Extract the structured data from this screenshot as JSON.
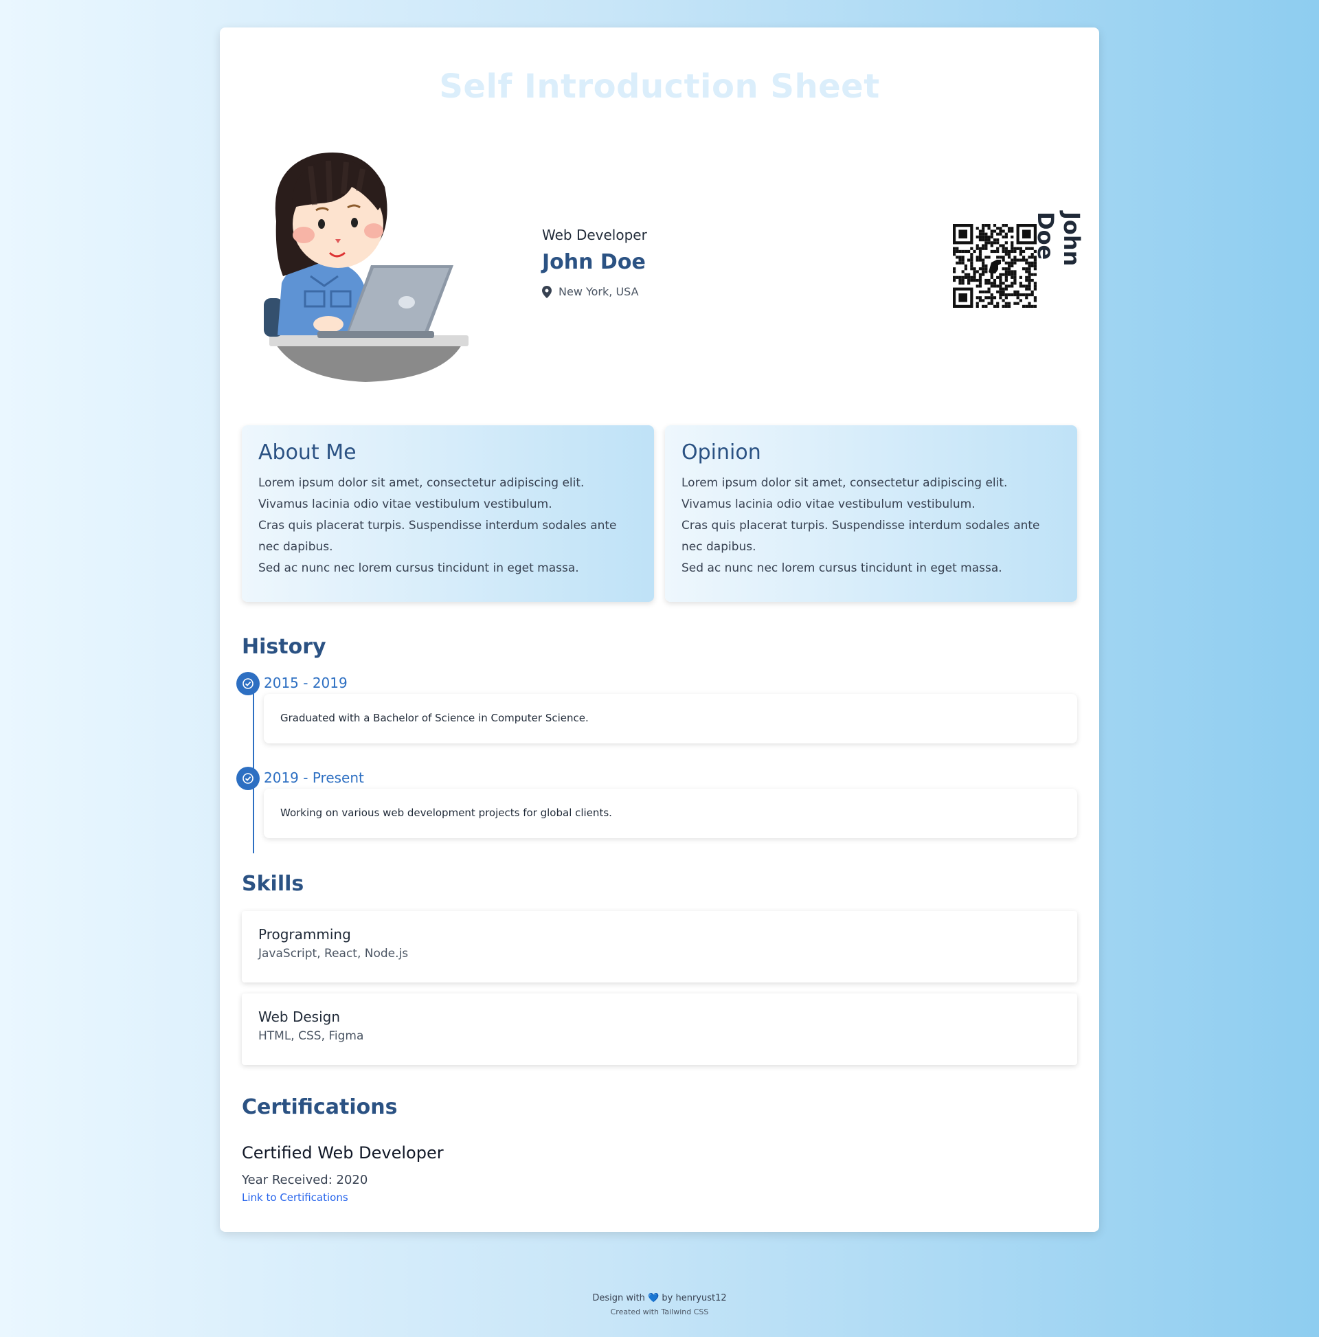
{
  "title": "Self Introduction Sheet",
  "profile": {
    "role": "Web Developer",
    "name": "John Doe",
    "location": "New York, USA",
    "vertical_name": "John Doe"
  },
  "about": {
    "heading": "About Me",
    "lines": [
      "Lorem ipsum dolor sit amet, consectetur adipiscing elit. Vivamus lacinia odio vitae vestibulum vestibulum.",
      "Cras quis placerat turpis. Suspendisse interdum sodales ante nec dapibus.",
      "Sed ac nunc nec lorem cursus tincidunt in eget massa."
    ]
  },
  "opinion": {
    "heading": "Opinion",
    "lines": [
      "Lorem ipsum dolor sit amet, consectetur adipiscing elit. Vivamus lacinia odio vitae vestibulum vestibulum.",
      "Cras quis placerat turpis. Suspendisse interdum sodales ante nec dapibus.",
      "Sed ac nunc nec lorem cursus tincidunt in eget massa."
    ]
  },
  "history": {
    "heading": "History",
    "items": [
      {
        "date": "2015 - 2019",
        "text": "Graduated with a Bachelor of Science in Computer Science."
      },
      {
        "date": "2019 - Present",
        "text": "Working on various web development projects for global clients."
      }
    ]
  },
  "skills": {
    "heading": "Skills",
    "items": [
      {
        "name": "Programming",
        "items": "JavaScript, React, Node.js"
      },
      {
        "name": "Web Design",
        "items": "HTML, CSS, Figma"
      }
    ]
  },
  "certifications": {
    "heading": "Certifications",
    "name": "Certified Web Developer",
    "year": "Year Received: 2020",
    "link": "Link to Certifications"
  },
  "footer": {
    "design_prefix": "Design with",
    "heart": "💙",
    "design_suffix": "by henryust12",
    "created": "Created with Tailwind CSS"
  },
  "colors": {
    "accent": "#2d6fc2",
    "heading": "#2b5283",
    "title": "#dbeefb"
  }
}
